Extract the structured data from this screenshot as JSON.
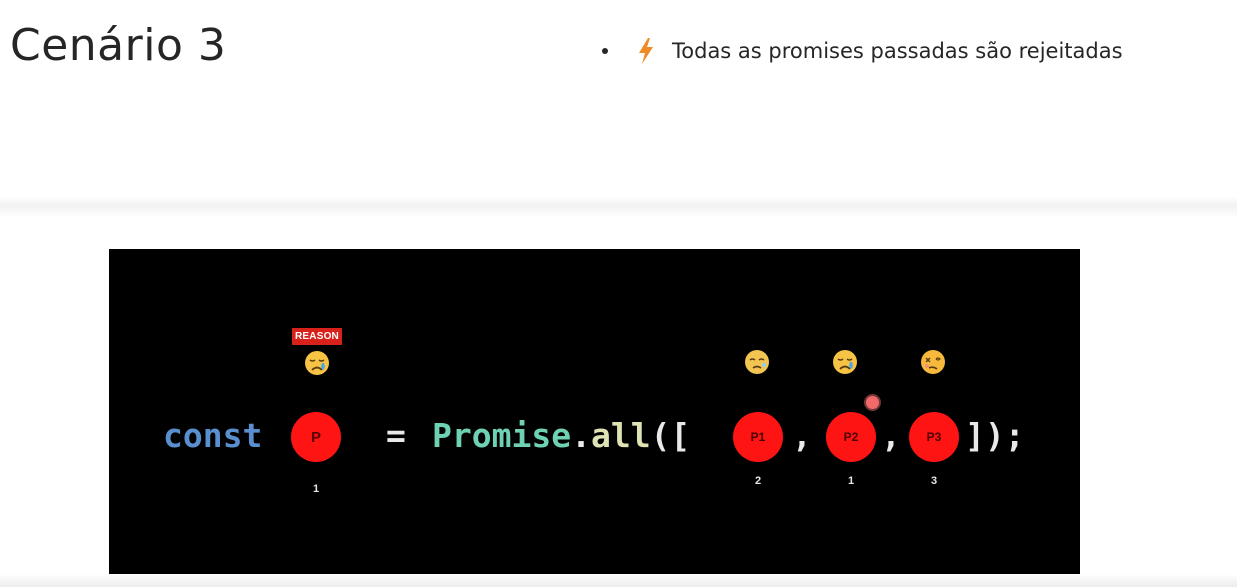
{
  "slide": {
    "title": "Cenário 3",
    "bullet_text": "Todas as promises passadas são rejeitadas",
    "bullet_icon": "lightning-bolt-icon"
  },
  "code_panel": {
    "keyword": "const",
    "operator": "=",
    "class_name": "Promise",
    "dot": ".",
    "method": "all",
    "open_brackets": "([",
    "comma": ",",
    "close_brackets": "]);",
    "result": {
      "label": "P",
      "badge": "REASON",
      "order": "1",
      "emoji": "sad-crying-face-icon"
    },
    "promises": [
      {
        "label": "P1",
        "order": "2",
        "emoji": "sleeping-sad-face-icon"
      },
      {
        "label": "P2",
        "order": "1",
        "emoji": "sad-crying-face-icon"
      },
      {
        "label": "P3",
        "order": "3",
        "emoji": "dizzy-face-icon"
      }
    ]
  },
  "colors": {
    "promise_rejected": "#ff1414",
    "keyword": "#5a8fcf",
    "class": "#6fd1b3",
    "method": "#dfe3b4",
    "bolt": "#f08a24",
    "reason_badge": "#d9211c"
  }
}
